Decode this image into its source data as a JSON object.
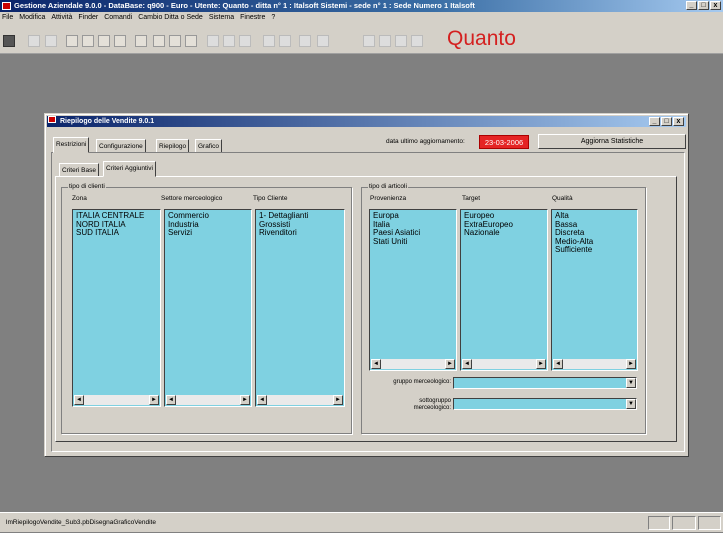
{
  "app": {
    "title": "Gestione Aziendale 9.0.0 - DataBase: q900 - Euro - Utente: Quanto - ditta n° 1 : Italsoft Sistemi - sede n° 1 : Sede Numero 1 Italsoft",
    "window_controls": [
      "_",
      "□",
      "x"
    ]
  },
  "menu": [
    "File",
    "Modifica",
    "Attività",
    "Finder",
    "Comandi",
    "Cambio Ditta o Sede",
    "Sistema",
    "Finestre",
    "?"
  ],
  "toolbar": {
    "logo": "Quanto"
  },
  "child": {
    "title": "Riepilogo delle Vendite 9.0.1",
    "window_controls": [
      "_",
      "□",
      "x"
    ],
    "tabs": [
      "Restrizioni",
      "Configurazione",
      "Riepilogo",
      "Grafico"
    ],
    "subtabs": [
      "Criteri Base",
      "Criteri Aggiuntivi"
    ],
    "date_label": "data ultimo aggiornamento:",
    "date_value": "23-03-2006",
    "update_button": "Aggiorna Statistiche",
    "clients_group": {
      "legend": "tipo di clienti",
      "columns": [
        {
          "header": "Zona",
          "items": [
            "ITALIA CENTRALE",
            "NORD ITALIA",
            "SUD ITALIA"
          ]
        },
        {
          "header": "Settore merceologico",
          "items": [
            "Commercio",
            "Industria",
            "Servizi"
          ]
        },
        {
          "header": "Tipo Cliente",
          "items": [
            "1- Dettaglianti",
            "Grossisti",
            "Rivenditori"
          ]
        }
      ]
    },
    "articles_group": {
      "legend": "tipo di articoli",
      "columns": [
        {
          "header": "Provenienza",
          "items": [
            "Europa",
            "Italia",
            "Paesi Asiatici",
            "Stati Uniti"
          ]
        },
        {
          "header": "Target",
          "items": [
            "Europeo",
            "ExtraEuropeo",
            "Nazionale"
          ]
        },
        {
          "header": "Qualità",
          "items": [
            "Alta",
            "Bassa",
            "Discreta",
            "Medio-Alta",
            "Sufficiente"
          ]
        }
      ],
      "gruppo_label": "gruppo merceologico:",
      "sottogruppo_label_1": "sottogruppo",
      "sottogruppo_label_2": "merceologico:"
    }
  },
  "statusbar": {
    "text": "lmRiepilogoVendite_Sub3.pbDisegnaGraficoVendite"
  },
  "colors": {
    "list_bg": "#7fd1e1",
    "date_bg": "#e52424",
    "title_bg": "#0a246a",
    "logo": "#d42020"
  }
}
